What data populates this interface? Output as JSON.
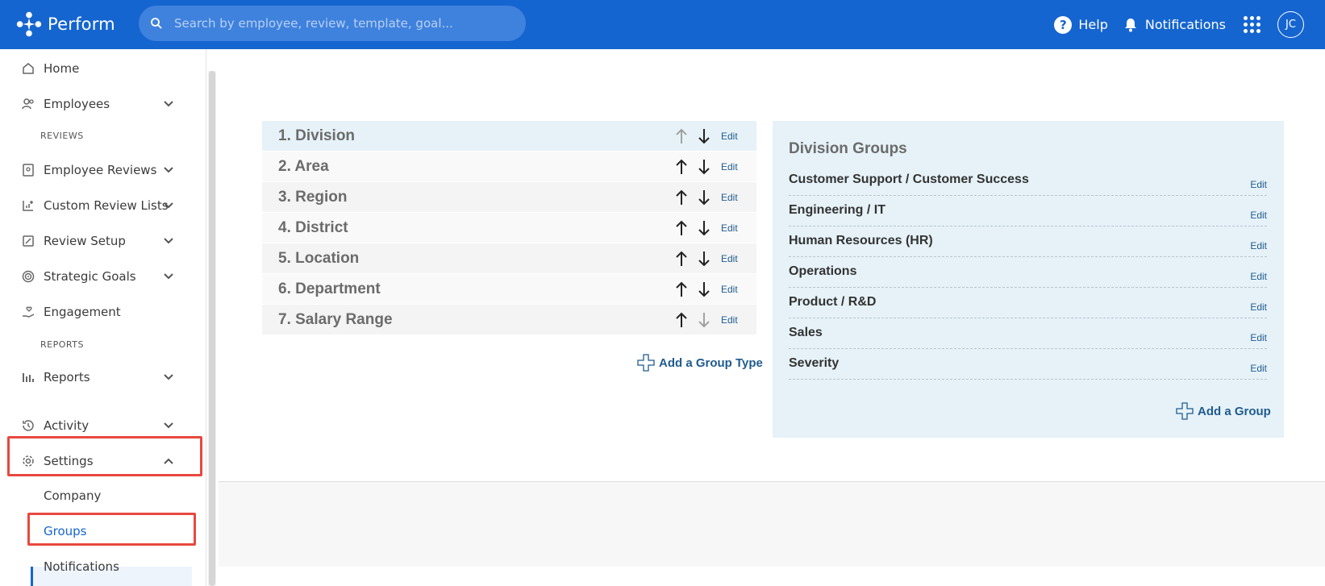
{
  "app": {
    "name": "Perform"
  },
  "search": {
    "placeholder": "Search by employee, review, template, goal..."
  },
  "header": {
    "help_label": "Help",
    "notifications_label": "Notifications",
    "avatar_initials": "JC"
  },
  "sidebar": {
    "home": "Home",
    "employees": "Employees",
    "reviews_section": "REVIEWS",
    "employee_reviews": "Employee Reviews",
    "custom_review_lists": "Custom Review Lists",
    "review_setup": "Review Setup",
    "strategic_goals": "Strategic Goals",
    "engagement": "Engagement",
    "reports_section": "REPORTS",
    "reports": "Reports",
    "activity": "Activity",
    "settings": "Settings",
    "settings_sub": {
      "company": "Company",
      "groups": "Groups",
      "notifications": "Notifications"
    }
  },
  "group_types": {
    "items": [
      {
        "label": "1. Division",
        "edit": "Edit"
      },
      {
        "label": "2. Area",
        "edit": "Edit"
      },
      {
        "label": "3. Region",
        "edit": "Edit"
      },
      {
        "label": "4. District",
        "edit": "Edit"
      },
      {
        "label": "5. Location",
        "edit": "Edit"
      },
      {
        "label": "6. Department",
        "edit": "Edit"
      },
      {
        "label": "7. Salary Range",
        "edit": "Edit"
      }
    ],
    "add_label": "Add a Group Type"
  },
  "groups": {
    "title": "Division Groups",
    "items": [
      {
        "name": "Customer Support / Customer Success",
        "edit": "Edit"
      },
      {
        "name": "Engineering / IT",
        "edit": "Edit"
      },
      {
        "name": "Human Resources (HR)",
        "edit": "Edit"
      },
      {
        "name": "Operations",
        "edit": "Edit"
      },
      {
        "name": "Product / R&D",
        "edit": "Edit"
      },
      {
        "name": "Sales",
        "edit": "Edit"
      },
      {
        "name": "Severity",
        "edit": "Edit"
      }
    ],
    "add_label": "Add a Group"
  },
  "colors": {
    "brand": "#1565d0",
    "link": "#1f5b8e",
    "panel": "#e6f2f8",
    "highlight": "#e8483f"
  }
}
